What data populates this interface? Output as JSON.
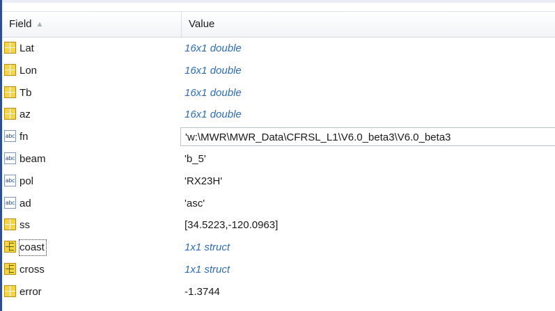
{
  "header": {
    "field_label": "Field",
    "sort_indicator": "▲",
    "value_label": "Value"
  },
  "rows": [
    {
      "icon": "grid-icon",
      "name": "Lat",
      "value": "16x1 double",
      "style": "italic"
    },
    {
      "icon": "grid-icon",
      "name": "Lon",
      "value": "16x1 double",
      "style": "italic"
    },
    {
      "icon": "grid-icon",
      "name": "Tb",
      "value": "16x1 double",
      "style": "italic"
    },
    {
      "icon": "grid-icon",
      "name": "az",
      "value": "16x1 double",
      "style": "italic"
    },
    {
      "icon": "abc-icon",
      "name": "fn",
      "value": "'w:\\MWR\\MWR_Data\\CFRSL_L1\\V6.0_beta3\\V6.0_beta3",
      "style": "boxed"
    },
    {
      "icon": "abc-icon",
      "name": "beam",
      "value": "'b_5'",
      "style": "plain"
    },
    {
      "icon": "abc-icon",
      "name": "pol",
      "value": "'RX23H'",
      "style": "plain"
    },
    {
      "icon": "abc-icon",
      "name": "ad",
      "value": "'asc'",
      "style": "plain"
    },
    {
      "icon": "grid-icon",
      "name": "ss",
      "value": "[34.5223,-120.0963]",
      "style": "plain"
    },
    {
      "icon": "struct-icon",
      "name": "coast",
      "value": "1x1 struct",
      "style": "italic",
      "focused": true
    },
    {
      "icon": "struct-icon",
      "name": "cross",
      "value": "1x1 struct",
      "style": "italic"
    },
    {
      "icon": "grid-icon",
      "name": "error",
      "value": "-1.3744",
      "style": "plain"
    }
  ],
  "icon_text": {
    "abc": "abc"
  },
  "colors": {
    "italic_value": "#2c6cb8",
    "icon_yellow": "#f6d53f",
    "left_edge": "#2b4d9b"
  }
}
